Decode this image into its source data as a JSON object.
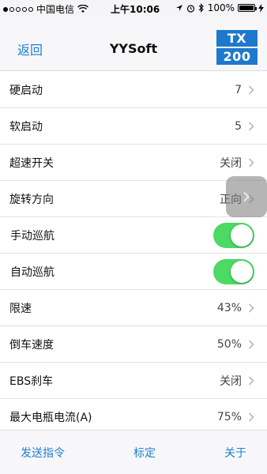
{
  "status_bar": {
    "carrier": "中国电信",
    "time": "上午10:06",
    "battery": "100%",
    "battery_level": 1.0
  },
  "nav": {
    "back_label": "返回",
    "title": "YYSoft",
    "badge_top": "TX",
    "badge_bottom": "200"
  },
  "rows": [
    {
      "label": "硬启动",
      "value": "7"
    },
    {
      "label": "软启动",
      "value": "5"
    },
    {
      "label": "超速开关",
      "value": "关闭"
    },
    {
      "label": "旋转方向",
      "value": "正向"
    },
    {
      "label": "手动巡航",
      "toggle": true
    },
    {
      "label": "自动巡航",
      "toggle": true
    },
    {
      "label": "限速",
      "value": "43%"
    },
    {
      "label": "倒车速度",
      "value": "50%"
    },
    {
      "label": "EBS刹车",
      "value": "关闭"
    },
    {
      "label": "最大电瓶电流(A)",
      "value": "75%"
    }
  ],
  "tabs": {
    "send": "发送指令",
    "calibrate": "标定",
    "about": "关于"
  },
  "colors": {
    "accent": "#1e7fd0",
    "badge": "#1e79cc",
    "toggle_on": "#4cd964"
  }
}
